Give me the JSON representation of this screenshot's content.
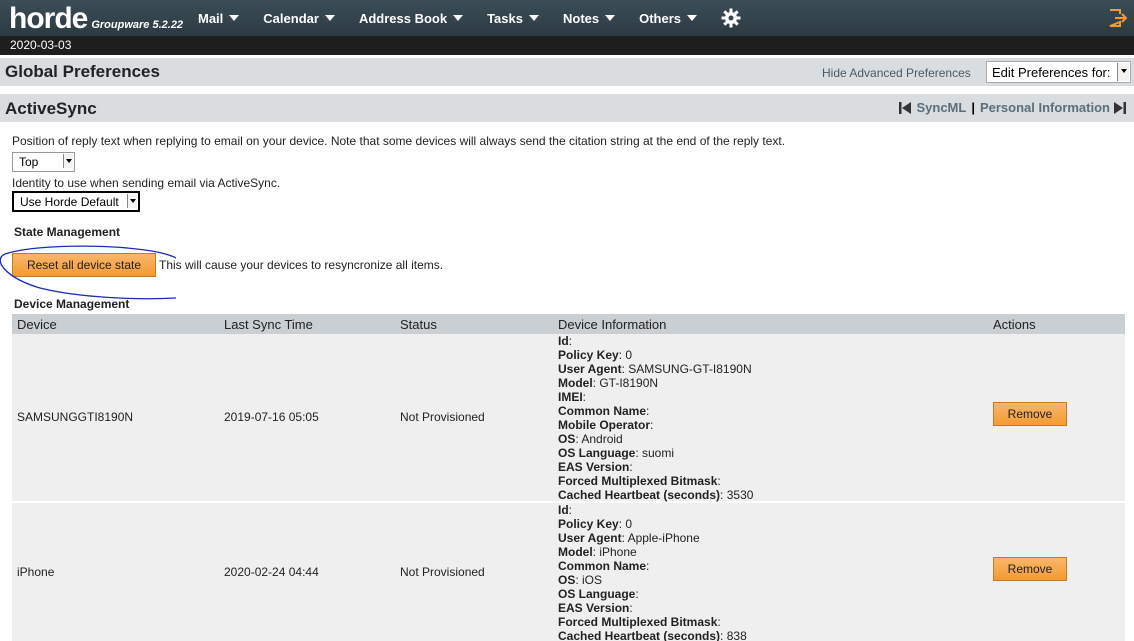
{
  "app": {
    "logo": "horde",
    "subtitle": "Groupware 5.2.22"
  },
  "menu": [
    {
      "label": "Mail"
    },
    {
      "label": "Calendar"
    },
    {
      "label": "Address Book"
    },
    {
      "label": "Tasks"
    },
    {
      "label": "Notes"
    },
    {
      "label": "Others"
    }
  ],
  "date": "2020-03-03",
  "global_prefs": {
    "title": "Global Preferences",
    "hide_advanced": "Hide Advanced Preferences",
    "edit_for": "Edit Preferences for:"
  },
  "section": {
    "title": "ActiveSync",
    "prev": "SyncML",
    "separator": "|",
    "next": "Personal Information"
  },
  "reply_position": {
    "label": "Position of reply text when replying to email on your device. Note that some devices will always send the citation string at the end of the reply text.",
    "value": "Top"
  },
  "identity": {
    "label": "Identity to use when sending email via ActiveSync.",
    "value": "Use Horde Default"
  },
  "state_management": {
    "title": "State Management",
    "button": "Reset all device state",
    "note": "This will cause your devices to resyncronize all items."
  },
  "device_management": {
    "title": "Device Management",
    "columns": [
      "Device",
      "Last Sync Time",
      "Status",
      "Device Information",
      "Actions"
    ],
    "rows": [
      {
        "device": "SAMSUNGGTI8190N",
        "last_sync": "2019-07-16 05:05",
        "status": "Not Provisioned",
        "info": [
          {
            "k": "Id",
            "v": ":"
          },
          {
            "k": "Policy Key",
            "v": ": 0"
          },
          {
            "k": "User Agent",
            "v": ": SAMSUNG-GT-I8190N"
          },
          {
            "k": "Model",
            "v": ": GT-I8190N"
          },
          {
            "k": "IMEI",
            "v": ":"
          },
          {
            "k": "Common Name",
            "v": ":"
          },
          {
            "k": "Mobile Operator",
            "v": ":"
          },
          {
            "k": "OS",
            "v": ": Android"
          },
          {
            "k": "OS Language",
            "v": ": suomi"
          },
          {
            "k": "EAS Version",
            "v": ":"
          },
          {
            "k": "Forced Multiplexed Bitmask",
            "v": ":"
          },
          {
            "k": "Cached Heartbeat (seconds)",
            "v": ": 3530"
          }
        ],
        "action": "Remove"
      },
      {
        "device": "iPhone",
        "last_sync": "2020-02-24 04:44",
        "status": "Not Provisioned",
        "info": [
          {
            "k": "Id",
            "v": ":"
          },
          {
            "k": "Policy Key",
            "v": ": 0"
          },
          {
            "k": "User Agent",
            "v": ": Apple-iPhone"
          },
          {
            "k": "Model",
            "v": ": iPhone"
          },
          {
            "k": "Common Name",
            "v": ":"
          },
          {
            "k": "OS",
            "v": ": iOS"
          },
          {
            "k": "OS Language",
            "v": ":"
          },
          {
            "k": "EAS Version",
            "v": ":"
          },
          {
            "k": "Forced Multiplexed Bitmask",
            "v": ":"
          },
          {
            "k": "Cached Heartbeat (seconds)",
            "v": ": 838"
          }
        ],
        "action": "Remove"
      }
    ]
  },
  "colors": {
    "topbar": "#2f3e46",
    "button_orange": "#f5a040",
    "annotation_ink": "#1d2bb8"
  }
}
